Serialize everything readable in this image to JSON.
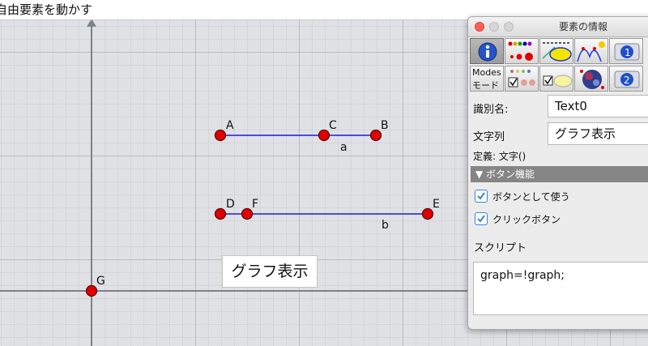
{
  "topbar": {
    "title": "自由要素を動かす"
  },
  "canvas": {
    "points": [
      {
        "name": "A"
      },
      {
        "name": "C"
      },
      {
        "name": "B"
      },
      {
        "name": "D"
      },
      {
        "name": "F"
      },
      {
        "name": "E"
      },
      {
        "name": "G"
      }
    ],
    "segments": [
      {
        "name": "a"
      },
      {
        "name": "b"
      }
    ],
    "text_button": {
      "label": "グラフ表示"
    }
  },
  "panel": {
    "title": "要素の情報",
    "modes_label_1": "Modes",
    "modes_label_2": "モード",
    "id_label": "識別名:",
    "id_value": "Text0",
    "string_label": "文字列",
    "string_value": "グラフ表示",
    "definition": "定義: 文字()",
    "section_title": "▼ ボタン機能",
    "checkbox_use_as_button": "ボタンとして使う",
    "checkbox_click_button": "クリックボタン",
    "script_label": "スクリプト",
    "script_value": "graph=!graph;"
  },
  "colors": {
    "point_fill": "#e00000",
    "segment": "#1a1adc",
    "grid": "#dfe1e5",
    "checkbox_accent": "#3b82d6"
  }
}
